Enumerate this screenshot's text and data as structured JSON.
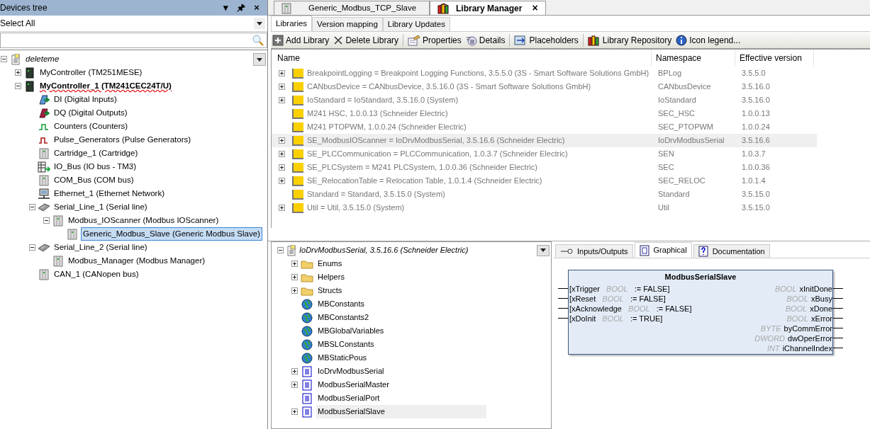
{
  "devices_panel": {
    "title": "Devices tree",
    "header_buttons": [
      "▾",
      "🖈",
      "×"
    ],
    "filter": {
      "value": "Select All"
    },
    "tree": [
      {
        "label": "deleteme",
        "kind": "project",
        "expanded": true,
        "selected": false,
        "active": false,
        "children": [
          {
            "label": "MyController (TM251MESE)",
            "kind": "controller",
            "expanded": false,
            "selected": false,
            "active": false
          },
          {
            "label": "MyController_1 (TM241CEC24T/U)",
            "kind": "controller",
            "expanded": true,
            "selected": false,
            "active": true,
            "children": [
              {
                "label": "DI (Digital Inputs)",
                "kind": "di",
                "selected": false,
                "active": false
              },
              {
                "label": "DQ (Digital Outputs)",
                "kind": "dq",
                "selected": false,
                "active": false
              },
              {
                "label": "Counters (Counters)",
                "kind": "counter",
                "selected": false,
                "active": false
              },
              {
                "label": "Pulse_Generators (Pulse Generators)",
                "kind": "pulse",
                "selected": false,
                "active": false
              },
              {
                "label": "Cartridge_1 (Cartridge)",
                "kind": "module",
                "selected": false,
                "active": false
              },
              {
                "label": "IO_Bus (IO bus - TM3)",
                "kind": "iobus",
                "selected": false,
                "active": false
              },
              {
                "label": "COM_Bus (COM bus)",
                "kind": "module",
                "selected": false,
                "active": false
              },
              {
                "label": "Ethernet_1 (Ethernet Network)",
                "kind": "ethernet",
                "selected": false,
                "active": false
              },
              {
                "label": "Serial_Line_1 (Serial line)",
                "kind": "serial",
                "expanded": true,
                "selected": false,
                "active": false,
                "children": [
                  {
                    "label": "Modbus_IOScanner (Modbus IOScanner)",
                    "kind": "module",
                    "expanded": true,
                    "selected": false,
                    "active": false,
                    "children": [
                      {
                        "label": "Generic_Modbus_Slave (Generic Modbus Slave)",
                        "kind": "module",
                        "selected": true,
                        "active": false
                      }
                    ]
                  }
                ]
              },
              {
                "label": "Serial_Line_2 (Serial line)",
                "kind": "serial",
                "expanded": true,
                "selected": false,
                "active": false,
                "children": [
                  {
                    "label": "Modbus_Manager (Modbus Manager)",
                    "kind": "module",
                    "selected": false,
                    "active": false
                  }
                ]
              },
              {
                "label": "CAN_1 (CANopen bus)",
                "kind": "module",
                "selected": false,
                "active": false
              }
            ]
          }
        ]
      }
    ]
  },
  "editor_tabs": [
    {
      "label": "Generic_Modbus_TCP_Slave",
      "kind": "module",
      "selected": false
    },
    {
      "label": "Library Manager",
      "kind": "library",
      "selected": true,
      "close": "×"
    }
  ],
  "library_manager": {
    "tabs": [
      {
        "label": "Libraries",
        "selected": true
      },
      {
        "label": "Version mapping",
        "selected": false
      },
      {
        "label": "Library Updates",
        "selected": false
      }
    ],
    "toolbar": [
      {
        "label": "Add Library",
        "kind": "add"
      },
      {
        "label": "Delete Library",
        "kind": "delete"
      },
      {
        "label": "Properties",
        "kind": "properties"
      },
      {
        "label": "Details",
        "kind": "details"
      },
      {
        "label": "Placeholders",
        "kind": "placeholders"
      },
      {
        "label": "Library Repository",
        "kind": "repository"
      },
      {
        "label": "Icon legend...",
        "kind": "info"
      }
    ],
    "table": {
      "columns": [
        "Name",
        "Namespace",
        "Effective version"
      ],
      "rows": [
        {
          "name": "BreakpointLogging = Breakpoint Logging Functions, 3.5.5.0 (3S - Smart Software Solutions GmbH)",
          "namespace": "BPLog",
          "version": "3.5.5.0",
          "expandable": true,
          "selected": false
        },
        {
          "name": "CANbusDevice = CANbusDevice, 3.5.16.0 (3S - Smart Software Solutions GmbH)",
          "namespace": "CANbusDevice",
          "version": "3.5.16.0",
          "expandable": true,
          "selected": false
        },
        {
          "name": "IoStandard = IoStandard, 3.5.16.0 (System)",
          "namespace": "IoStandard",
          "version": "3.5.16.0",
          "expandable": true,
          "selected": false
        },
        {
          "name": "M241 HSC, 1.0.0.13 (Schneider Electric)",
          "namespace": "SEC_HSC",
          "version": "1.0.0.13",
          "expandable": false,
          "selected": false
        },
        {
          "name": "M241 PTOPWM, 1.0.0.24 (Schneider Electric)",
          "namespace": "SEC_PTOPWM",
          "version": "1.0.0.24",
          "expandable": false,
          "selected": false
        },
        {
          "name": "SE_ModbusIOScanner = IoDrvModbusSerial, 3.5.16.6 (Schneider Electric)",
          "namespace": "IoDrvModbusSerial",
          "version": "3.5.16.6",
          "expandable": true,
          "selected": true
        },
        {
          "name": "SE_PLCCommunication = PLCCommunication, 1.0.3.7 (Schneider Electric)",
          "namespace": "SEN",
          "version": "1.0.3.7",
          "expandable": true,
          "selected": false
        },
        {
          "name": "SE_PLCSystem = M241 PLCSystem, 1.0.0.36 (Schneider Electric)",
          "namespace": "SEC",
          "version": "1.0.0.36",
          "expandable": true,
          "selected": false
        },
        {
          "name": "SE_RelocationTable = Relocation Table, 1.0.1.4 (Schneider Electric)",
          "namespace": "SEC_RELOC",
          "version": "1.0.1.4",
          "expandable": true,
          "selected": false
        },
        {
          "name": "Standard = Standard, 3.5.15.0 (System)",
          "namespace": "Standard",
          "version": "3.5.15.0",
          "expandable": false,
          "selected": false
        },
        {
          "name": "Util = Util, 3.5.15.0 (System)",
          "namespace": "Util",
          "version": "3.5.15.0",
          "expandable": true,
          "selected": false
        }
      ]
    },
    "library_tree": {
      "root": "IoDrvModbusSerial, 3.5.16.6 (Schneider Electric)",
      "items": [
        {
          "label": "Enums",
          "kind": "folder",
          "expandable": true,
          "selected": false
        },
        {
          "label": "Helpers",
          "kind": "folder",
          "expandable": true,
          "selected": false
        },
        {
          "label": "Structs",
          "kind": "folder",
          "expandable": true,
          "selected": false
        },
        {
          "label": "MBConstants",
          "kind": "globals",
          "expandable": false,
          "selected": false
        },
        {
          "label": "MBConstants2",
          "kind": "globals",
          "expandable": false,
          "selected": false
        },
        {
          "label": "MBGlobalVariables",
          "kind": "globals",
          "expandable": false,
          "selected": false
        },
        {
          "label": "MBSLConstants",
          "kind": "globals",
          "expandable": false,
          "selected": false
        },
        {
          "label": "MBStaticPous",
          "kind": "globals",
          "expandable": false,
          "selected": false
        },
        {
          "label": "IoDrvModbusSerial",
          "kind": "pou",
          "expandable": true,
          "selected": false
        },
        {
          "label": "ModbusSerialMaster",
          "kind": "pou",
          "expandable": true,
          "selected": false
        },
        {
          "label": "ModbusSerialPort",
          "kind": "pou",
          "expandable": false,
          "selected": false
        },
        {
          "label": "ModbusSerialSlave",
          "kind": "pou",
          "expandable": true,
          "selected": true
        }
      ]
    },
    "detail_tabs": [
      {
        "label": "Inputs/Outputs",
        "kind": "io",
        "selected": false
      },
      {
        "label": "Graphical",
        "kind": "graphical",
        "selected": true
      },
      {
        "label": "Documentation",
        "kind": "doc",
        "selected": false
      }
    ],
    "function_block": {
      "title": "ModbusSerialSlave",
      "inputs": [
        {
          "name": "[xTrigger",
          "type": "BOOL",
          "default": ":= FALSE]"
        },
        {
          "name": "[xReset",
          "type": "BOOL",
          "default": ":= FALSE]"
        },
        {
          "name": "[xAcknowledge",
          "type": "BOOL",
          "default": ":= FALSE]"
        },
        {
          "name": "[xDoInit",
          "type": "BOOL",
          "default": ":= TRUE]"
        }
      ],
      "outputs": [
        {
          "type": "BOOL",
          "name": "xInitDone"
        },
        {
          "type": "BOOL",
          "name": "xBusy"
        },
        {
          "type": "BOOL",
          "name": "xDone"
        },
        {
          "type": "BOOL",
          "name": "xError"
        },
        {
          "type": "BYTE",
          "name": "byCommError"
        },
        {
          "type": "DWORD",
          "name": "dwOperError"
        },
        {
          "type": "INT",
          "name": "iChannelIndex"
        }
      ]
    }
  }
}
